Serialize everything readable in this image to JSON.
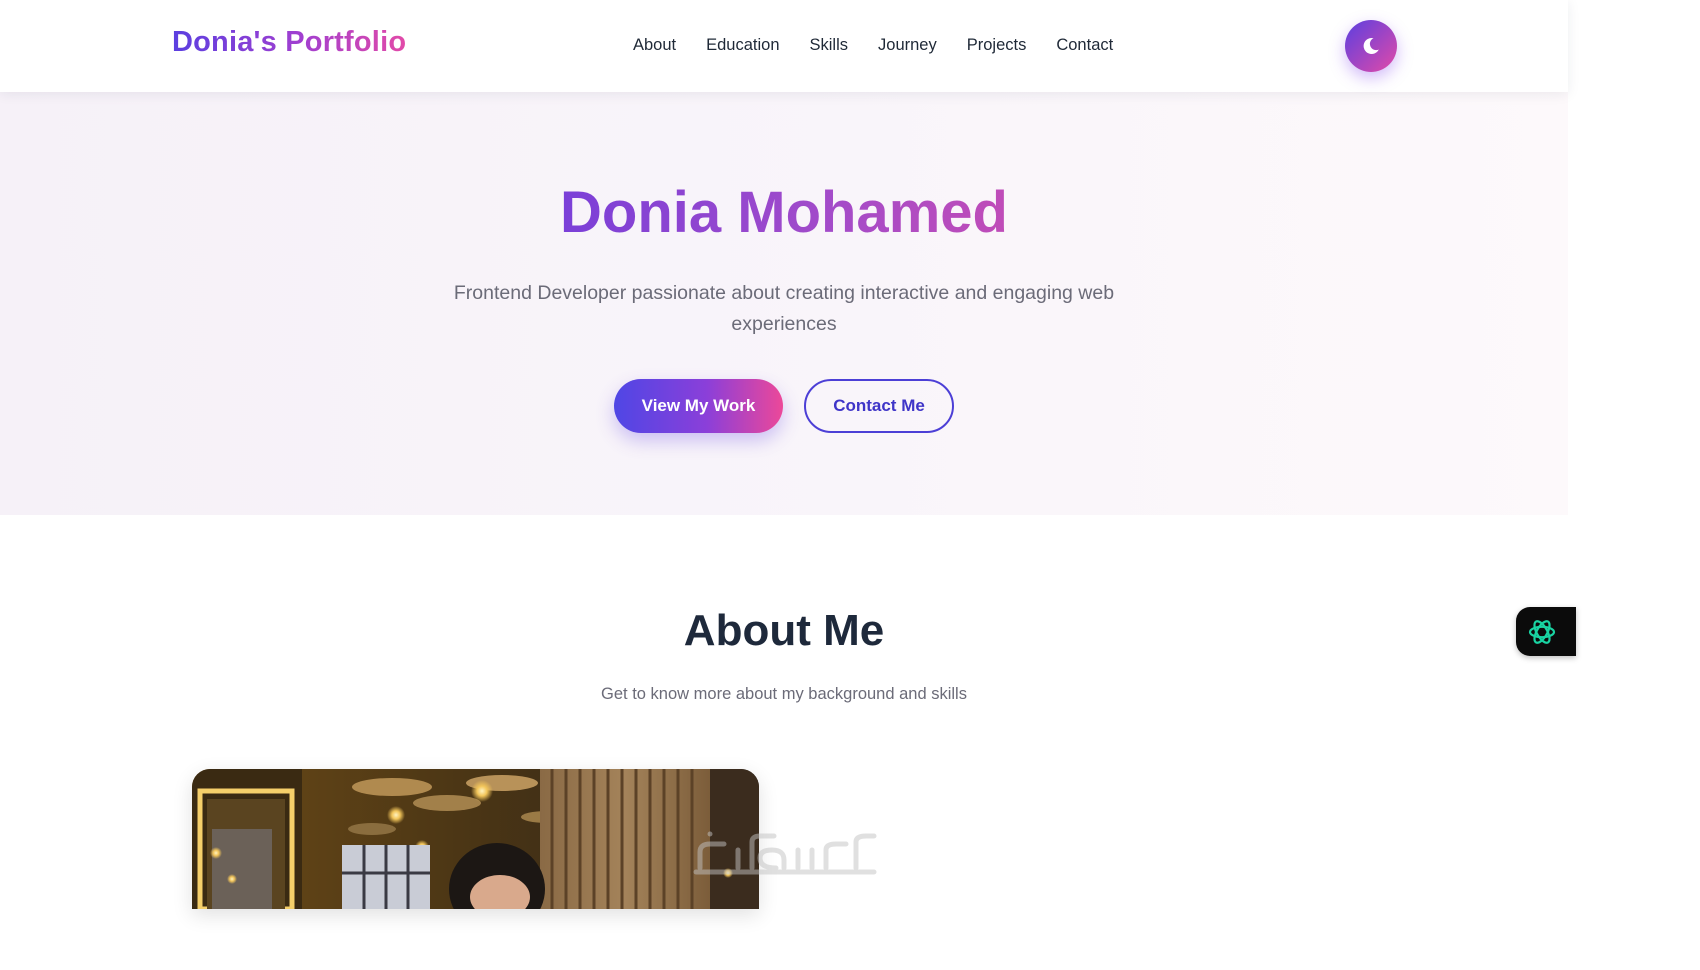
{
  "header": {
    "logo": "Donia's Portfolio",
    "nav": [
      {
        "label": "About"
      },
      {
        "label": "Education"
      },
      {
        "label": "Skills"
      },
      {
        "label": "Journey"
      },
      {
        "label": "Projects"
      },
      {
        "label": "Contact"
      }
    ],
    "theme_toggle_icon": "moon-icon"
  },
  "hero": {
    "name": "Donia Mohamed",
    "subtitle": "Frontend Developer passionate about creating interactive and engaging web experiences",
    "primary_button": "View My Work",
    "secondary_button": "Contact Me"
  },
  "about": {
    "title": "About Me",
    "subtitle": "Get to know more about my background and skills"
  },
  "widgets": {
    "assistant_icon": "openai-knot-icon"
  },
  "colors": {
    "accent_start": "#4f46e5",
    "accent_mid": "#8b3fd9",
    "accent_end": "#ec4899",
    "text_dark": "#1e293b",
    "text_muted": "#6b6b78",
    "hero_bg": "#f7f2f9"
  }
}
